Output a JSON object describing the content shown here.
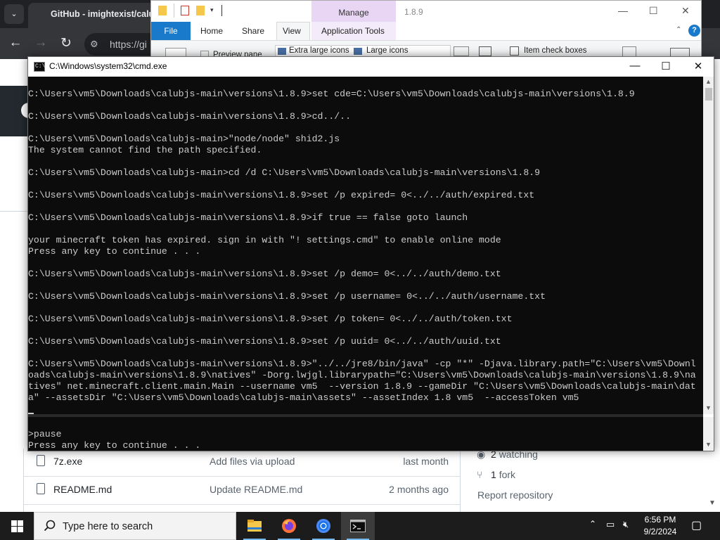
{
  "browser": {
    "tab_title": "GitHub - imightexist/calubjs-main",
    "url": "https://gi",
    "back_icon": "arrow-left-icon",
    "forward_icon": "arrow-right-icon",
    "reload_icon": "reload-icon",
    "files": [
      {
        "name": "7z.exe",
        "message": "Add files via upload",
        "date": "last month"
      },
      {
        "name": "README.md",
        "message": "Update README.md",
        "date": "2 months ago"
      }
    ],
    "sidebar": {
      "watching": "2",
      "watching_label": "watching",
      "forks": "1",
      "forks_label": "fork",
      "report": "Report repository"
    }
  },
  "explorer": {
    "version": "1.8.9",
    "manage_tab": "Manage",
    "tabs": {
      "file": "File",
      "home": "Home",
      "share": "Share",
      "view": "View",
      "app_tools": "Application Tools"
    },
    "ribbon": {
      "preview_pane": "Preview pane",
      "extra_large_icons": "Extra large icons",
      "large_icons": "Large icons",
      "item_check_boxes": "Item check boxes"
    },
    "controls": {
      "minimize": "—",
      "maximize": "☐",
      "close": "✕",
      "help": "?"
    }
  },
  "cmd": {
    "title": "C:\\Windows\\system32\\cmd.exe",
    "controls": {
      "minimize": "—",
      "maximize": "☐",
      "close": "✕"
    },
    "lines": [
      "C:\\Users\\vm5\\Downloads\\calubjs-main\\versions\\1.8.9>set cde=C:\\Users\\vm5\\Downloads\\calubjs-main\\versions\\1.8.9",
      "",
      "C:\\Users\\vm5\\Downloads\\calubjs-main\\versions\\1.8.9>cd../..",
      "",
      "C:\\Users\\vm5\\Downloads\\calubjs-main>\"node/node\" shid2.js",
      "The system cannot find the path specified.",
      "",
      "C:\\Users\\vm5\\Downloads\\calubjs-main>cd /d C:\\Users\\vm5\\Downloads\\calubjs-main\\versions\\1.8.9",
      "",
      "C:\\Users\\vm5\\Downloads\\calubjs-main\\versions\\1.8.9>set /p expired= 0<../../auth/expired.txt",
      "",
      "C:\\Users\\vm5\\Downloads\\calubjs-main\\versions\\1.8.9>if true == false goto launch",
      "",
      "your minecraft token has expired. sign in with \"! settings.cmd\" to enable online mode",
      "Press any key to continue . . .",
      "",
      "C:\\Users\\vm5\\Downloads\\calubjs-main\\versions\\1.8.9>set /p demo= 0<../../auth/demo.txt",
      "",
      "C:\\Users\\vm5\\Downloads\\calubjs-main\\versions\\1.8.9>set /p username= 0<../../auth/username.txt",
      "",
      "C:\\Users\\vm5\\Downloads\\calubjs-main\\versions\\1.8.9>set /p token= 0<../../auth/token.txt",
      "",
      "C:\\Users\\vm5\\Downloads\\calubjs-main\\versions\\1.8.9>set /p uuid= 0<../../auth/uuid.txt",
      "",
      "C:\\Users\\vm5\\Downloads\\calubjs-main\\versions\\1.8.9>\"../../jre8/bin/java\" -cp \"*\" -Djava.library.path=\"C:\\Users\\vm5\\Downl",
      "oads\\calubjs-main\\versions\\1.8.9\\natives\" -Dorg.lwjgl.librarypath=\"C:\\Users\\vm5\\Downloads\\calubjs-main\\versions\\1.8.9\\na",
      "tives\" net.minecraft.client.main.Main --username vm5  --version 1.8.9 --gameDir \"C:\\Users\\vm5\\Downloads\\calubjs-main\\dat",
      "a\" --assetsDir \"C:\\Users\\vm5\\Downloads\\calubjs-main\\assets\" --assetIndex 1.8 vm5  --accessToken vm5"
    ],
    "bottom_lines": [
      ">pause",
      "Press any key to continue . . ."
    ]
  },
  "taskbar": {
    "search_placeholder": "Type here to search",
    "apps": [
      "file-explorer-icon",
      "firefox-icon",
      "chrome-icon",
      "terminal-icon"
    ],
    "time": "6:56 PM",
    "date": "9/2/2024"
  }
}
